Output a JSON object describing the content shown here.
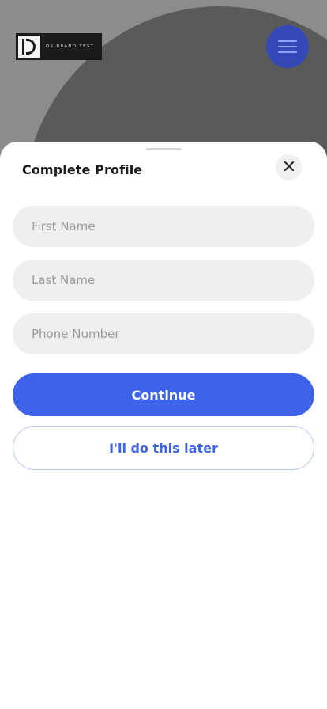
{
  "brand": {
    "logo_text": "DS BRAND TEST"
  },
  "header": {
    "menu_icon": "hamburger-menu-icon"
  },
  "sheet": {
    "title": "Complete Profile",
    "close_icon": "close-icon",
    "fields": {
      "first_name": {
        "placeholder": "First Name",
        "value": ""
      },
      "last_name": {
        "placeholder": "Last Name",
        "value": ""
      },
      "phone_number": {
        "placeholder": "Phone Number",
        "value": ""
      }
    },
    "continue_label": "Continue",
    "later_label": "I'll do this later"
  },
  "colors": {
    "accent": "#3c63ea",
    "menu_button": "#3448b8",
    "field_background": "#efefef",
    "backdrop": "#8c8c8c"
  }
}
